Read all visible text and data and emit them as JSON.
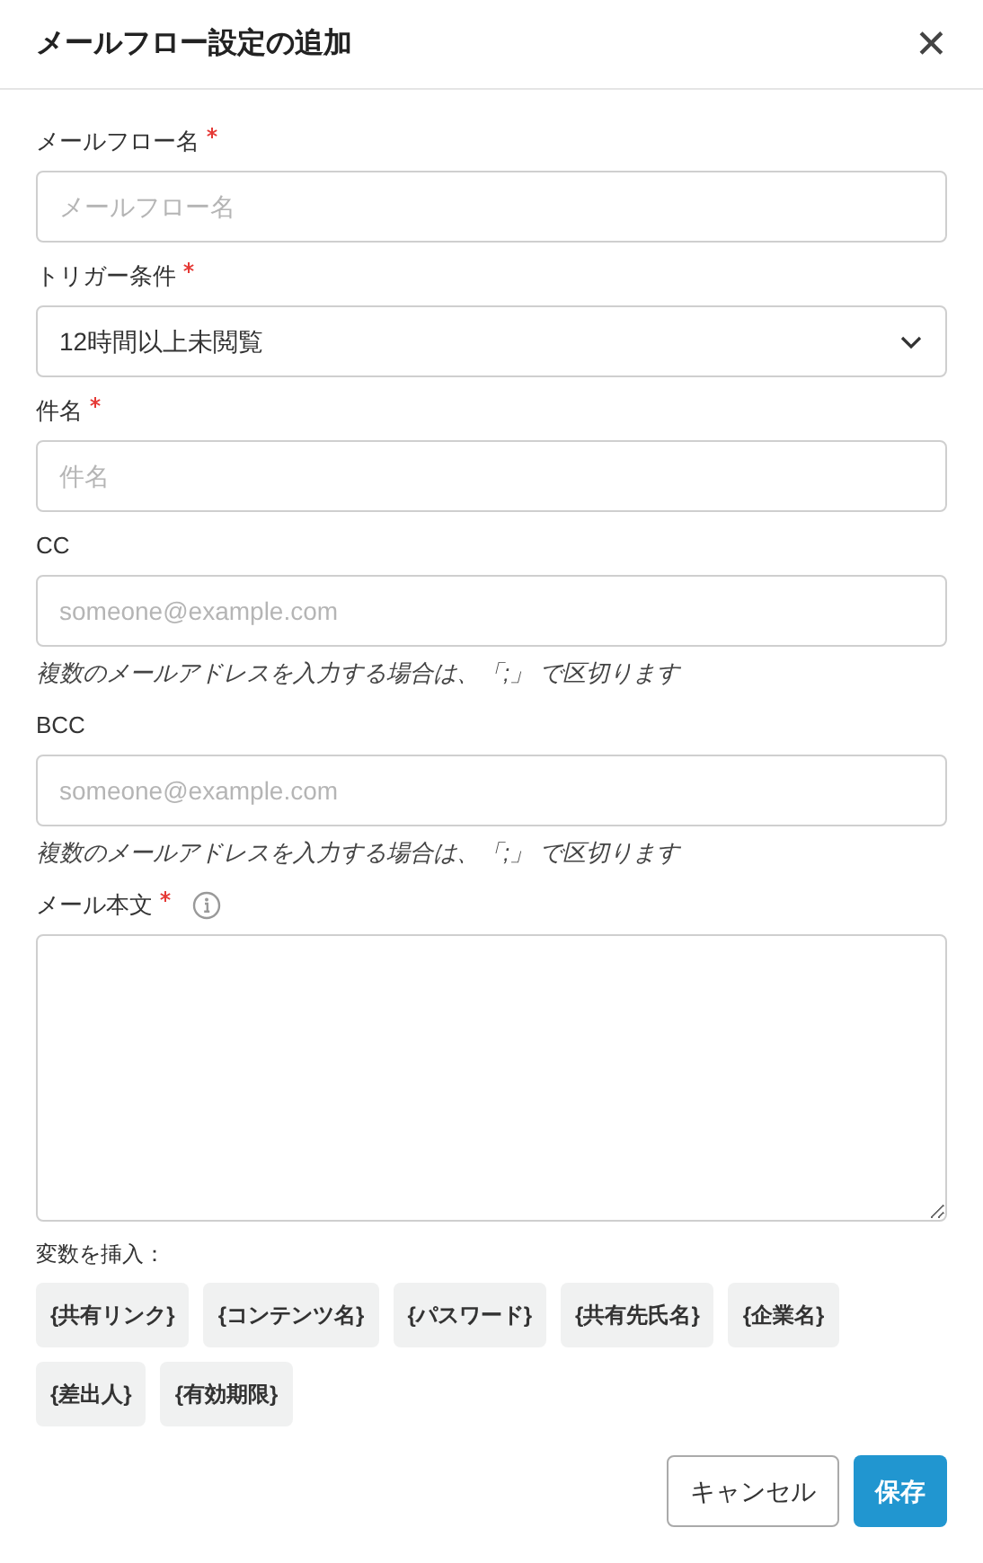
{
  "dialog": {
    "title": "メールフロー設定の追加",
    "close": "✕"
  },
  "fields": [
    {
      "kind": "text",
      "label": "メールフロー名",
      "required": true,
      "placeholder": "メールフロー名"
    },
    {
      "kind": "select",
      "label": "トリガー条件",
      "required": true,
      "value": "12時間以上未閲覧"
    },
    {
      "kind": "text",
      "label": "件名",
      "required": true,
      "placeholder": "件名"
    },
    {
      "kind": "text",
      "label": "CC",
      "required": false,
      "placeholder": "someone@example.com",
      "hint": "複数のメールアドレスを入力する場合は、「;」 で区切ります"
    },
    {
      "kind": "text",
      "label": "BCC",
      "required": false,
      "placeholder": "someone@example.com",
      "hint": "複数のメールアドレスを入力する場合は、「;」 で区切ります"
    },
    {
      "kind": "textarea",
      "label": "メール本文",
      "required": true,
      "info": true
    }
  ],
  "variables": {
    "label": "変数を挿入：",
    "items": [
      "{共有リンク}",
      "{コンテンツ名}",
      "{パスワード}",
      "{共有先氏名}",
      "{企業名}",
      "{差出人}",
      "{有効期限}"
    ]
  },
  "buttons": [
    {
      "kind": "secondary",
      "label": "キャンセル"
    },
    {
      "kind": "primary",
      "label": "保存"
    }
  ]
}
